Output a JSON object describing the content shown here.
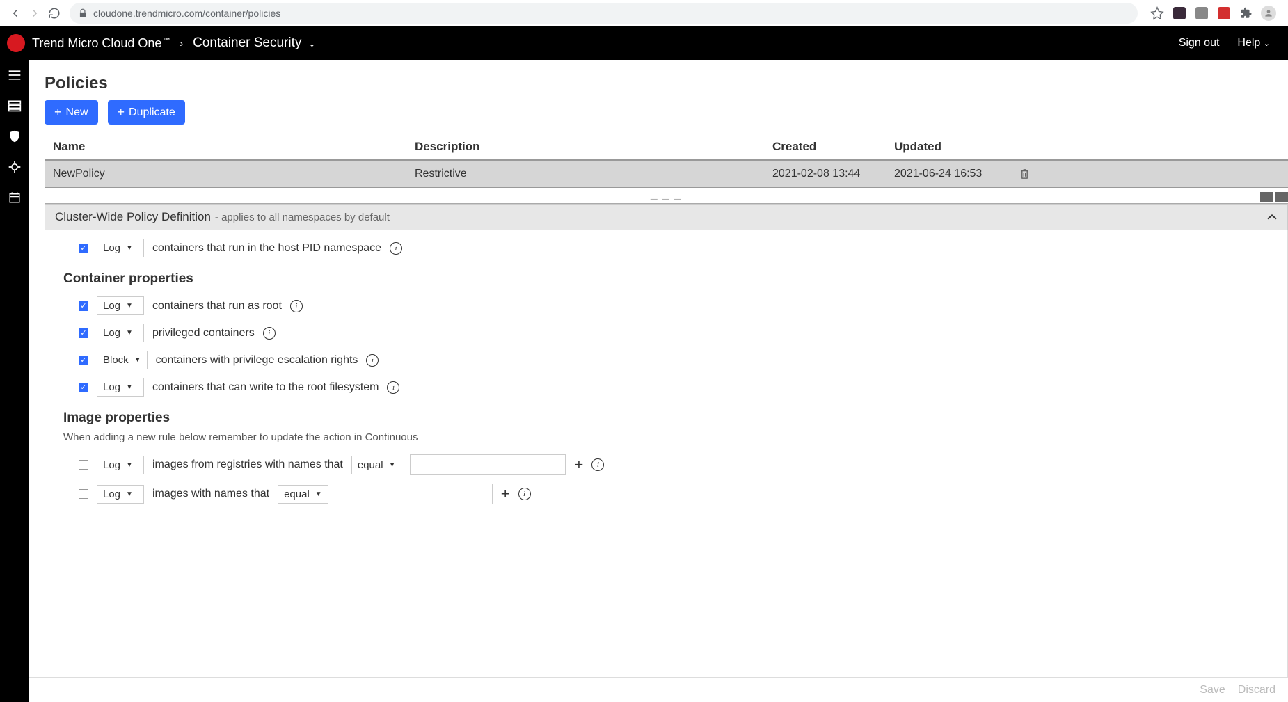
{
  "browser": {
    "url": "cloudone.trendmicro.com/container/policies"
  },
  "header": {
    "brand": "Trend Micro Cloud One",
    "section": "Container Security",
    "sign_out": "Sign out",
    "help": "Help"
  },
  "page": {
    "title": "Policies",
    "new_btn": "New",
    "duplicate_btn": "Duplicate"
  },
  "table": {
    "headers": {
      "name": "Name",
      "description": "Description",
      "created": "Created",
      "updated": "Updated"
    },
    "rows": [
      {
        "name": "NewPolicy",
        "description": "Restrictive",
        "created": "2021-02-08 13:44",
        "updated": "2021-06-24 16:53"
      }
    ]
  },
  "panel": {
    "title": "Cluster-Wide Policy Definition",
    "subtitle": "- applies to all namespaces by default",
    "top_rule": {
      "checked": true,
      "action": "Log",
      "text": "containers that run in the host PID namespace"
    },
    "container_heading": "Container properties",
    "container_rules": [
      {
        "checked": true,
        "action": "Log",
        "text": "containers that run as root"
      },
      {
        "checked": true,
        "action": "Log",
        "text": "privileged containers"
      },
      {
        "checked": true,
        "action": "Block",
        "text": "containers with privilege escalation rights"
      },
      {
        "checked": true,
        "action": "Log",
        "text": "containers that can write to the root filesystem"
      }
    ],
    "image_heading": "Image properties",
    "image_note": "When adding a new rule below remember to update the action in Continuous",
    "image_rules": [
      {
        "checked": false,
        "action": "Log",
        "text": "images from registries with names that",
        "operator": "equal",
        "value": ""
      },
      {
        "checked": false,
        "action": "Log",
        "text": "images with names that",
        "operator": "equal",
        "value": ""
      }
    ]
  },
  "savebar": {
    "save": "Save",
    "discard": "Discard"
  }
}
